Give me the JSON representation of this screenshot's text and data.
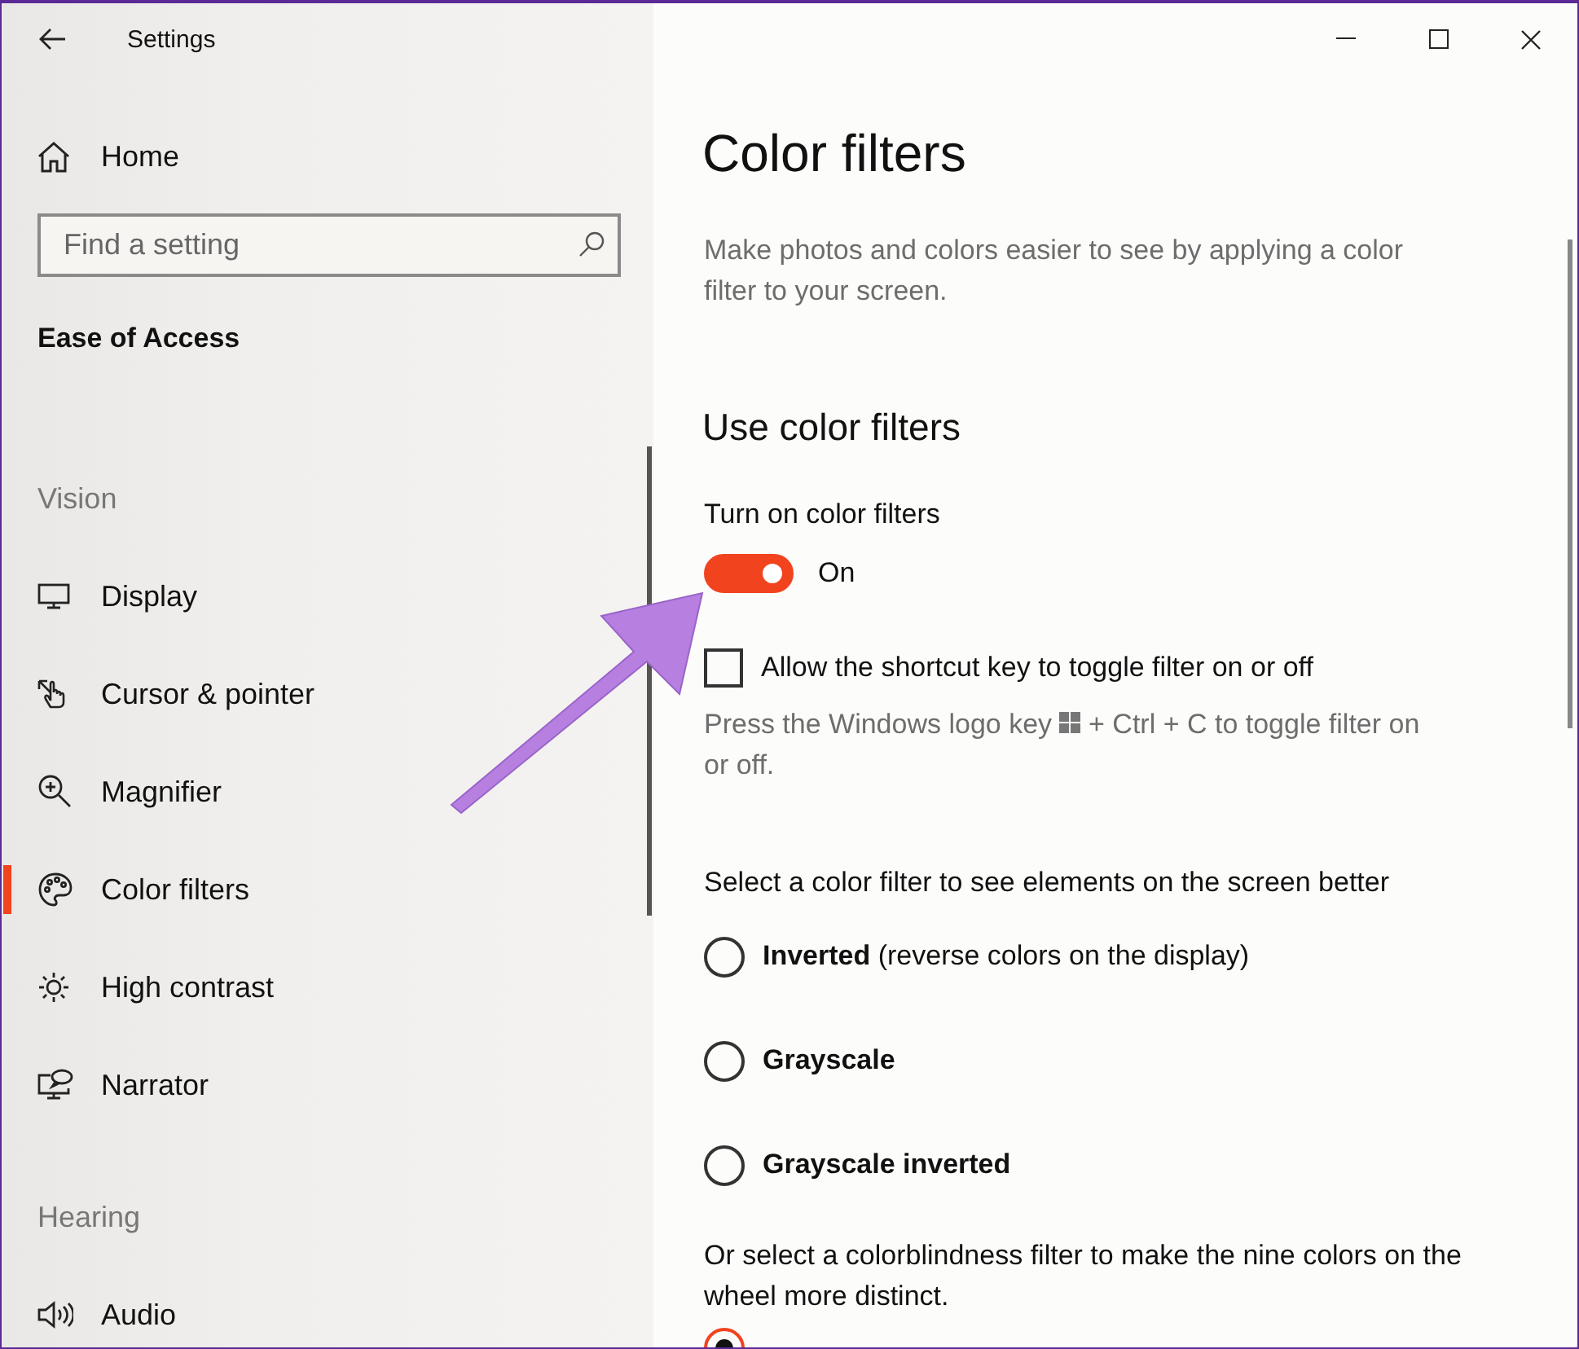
{
  "window": {
    "title": "Settings"
  },
  "sidebar": {
    "home": "Home",
    "search": {
      "placeholder": "Find a setting"
    },
    "section": "Ease of Access",
    "groups": [
      {
        "heading": "Vision",
        "items": [
          {
            "label": "Display",
            "selected": false
          },
          {
            "label": "Cursor & pointer",
            "selected": false
          },
          {
            "label": "Magnifier",
            "selected": false
          },
          {
            "label": "Color filters",
            "selected": true
          },
          {
            "label": "High contrast",
            "selected": false
          },
          {
            "label": "Narrator",
            "selected": false
          }
        ]
      },
      {
        "heading": "Hearing",
        "items": [
          {
            "label": "Audio",
            "selected": false
          }
        ]
      }
    ]
  },
  "content": {
    "title": "Color filters",
    "description": "Make photos and colors easier to see by applying a color filter to your screen.",
    "section": "Use color filters",
    "toggle": {
      "label": "Turn on color filters",
      "on": true,
      "state_text": "On"
    },
    "shortcut": {
      "label": "Allow the shortcut key to toggle filter on or off",
      "checked": false,
      "hint_before": "Press the Windows logo key",
      "hint_after": "+ Ctrl + C to toggle filter on",
      "hint_continued": "or off."
    },
    "filter_prompt": "Select a color filter to see elements on the screen better",
    "filters": [
      {
        "label": "Inverted",
        "note": "(reverse colors on the display)",
        "selected": false
      },
      {
        "label": "Grayscale",
        "selected": false
      },
      {
        "label": "Grayscale inverted",
        "selected": false
      }
    ],
    "colorblind_prompt": "Or select a colorblindness filter to make the nine colors on the wheel more distinct.",
    "colorblind_filters": [
      {
        "selected": true
      }
    ]
  }
}
